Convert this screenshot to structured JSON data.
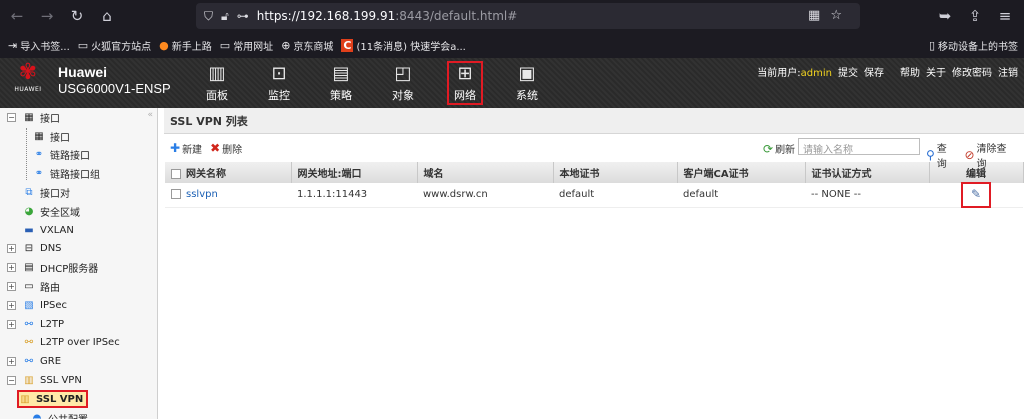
{
  "browser": {
    "url_host": "https://192.168.199.91",
    "url_rest": ":8443/default.html#",
    "bookmarks": [
      {
        "icon": "import-icon",
        "label": "导入书签..."
      },
      {
        "icon": "folder-icon",
        "label": "火狐官方站点"
      },
      {
        "icon": "firefox-icon",
        "label": "新手上路"
      },
      {
        "icon": "folder-icon",
        "label": "常用网址"
      },
      {
        "icon": "globe-icon",
        "label": "京东商城"
      },
      {
        "icon": "c-site-icon",
        "label": "(11条消息) 快速学会a..."
      }
    ],
    "mobile_bookmarks": "移动设备上的书签"
  },
  "header": {
    "logo_text": "HUAWEI",
    "brand_line1": "Huawei",
    "brand_line2": "USG6000V1-ENSP",
    "nav": [
      {
        "label": "面板",
        "icon": "dashboard-icon"
      },
      {
        "label": "监控",
        "icon": "monitor-icon"
      },
      {
        "label": "策略",
        "icon": "policy-icon"
      },
      {
        "label": "对象",
        "icon": "object-icon"
      },
      {
        "label": "网络",
        "icon": "network-icon",
        "active": true
      },
      {
        "label": "系统",
        "icon": "system-icon"
      }
    ],
    "user_label": "当前用户:",
    "username": "admin",
    "links": [
      "提交",
      "保存",
      "帮助",
      "关于",
      "修改密码",
      "注销"
    ]
  },
  "sidebar": {
    "items": [
      {
        "label": "接口",
        "box": "−"
      },
      {
        "label": "接口"
      },
      {
        "label": "链路接口"
      },
      {
        "label": "链路接口组"
      },
      {
        "label": "接口对"
      },
      {
        "label": "安全区域"
      },
      {
        "label": "VXLAN"
      },
      {
        "label": "DNS",
        "box": "+"
      },
      {
        "label": "DHCP服务器",
        "box": "+"
      },
      {
        "label": "路由",
        "box": "+"
      },
      {
        "label": "IPSec",
        "box": "+"
      },
      {
        "label": "L2TP",
        "box": "+"
      },
      {
        "label": "L2TP over IPSec"
      },
      {
        "label": "GRE",
        "box": "+"
      },
      {
        "label": "SSL VPN",
        "box": "−"
      },
      {
        "label": "SSL VPN"
      },
      {
        "label": "公共配置"
      }
    ]
  },
  "content": {
    "title": "SSL VPN 列表",
    "new_label": "新建",
    "delete_label": "删除",
    "refresh_label": "刷新",
    "search_placeholder": "请输入名称",
    "query_label": "查询",
    "clear_query_label": "清除查询",
    "columns": [
      "网关名称",
      "网关地址:端口",
      "域名",
      "本地证书",
      "客户端CA证书",
      "证书认证方式",
      "编辑"
    ],
    "rows": [
      {
        "name": "sslvpn",
        "address": "1.1.1.1:11443",
        "domain": "www.dsrw.cn",
        "local_cert": "default",
        "client_ca": "default",
        "auth": "-- NONE --"
      }
    ]
  }
}
